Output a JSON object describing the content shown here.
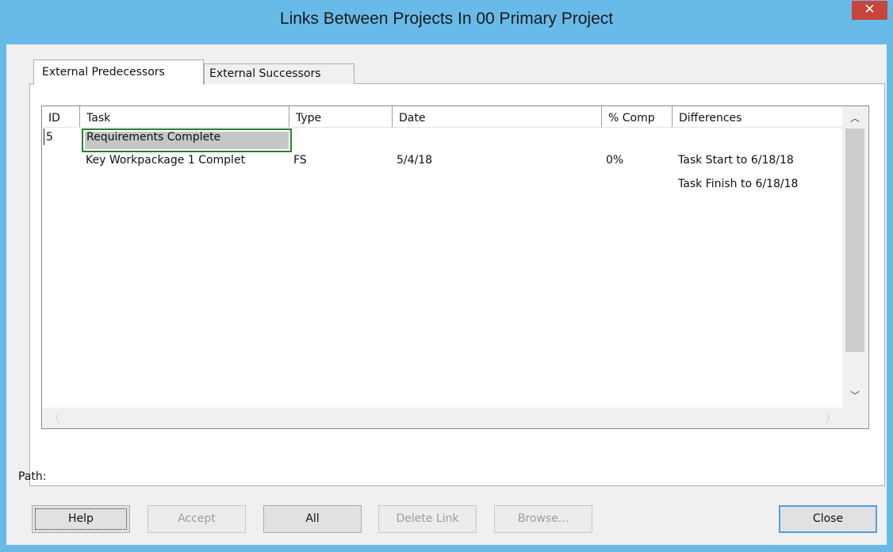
{
  "window": {
    "title": "Links Between Projects In 00 Primary Project",
    "close_glyph": "✕"
  },
  "tabs": [
    {
      "label": "External Predecessors",
      "active": true
    },
    {
      "label": "External Successors",
      "active": false
    }
  ],
  "grid": {
    "columns": [
      "ID",
      "Task",
      "Type",
      "Date",
      "% Comp",
      "Differences"
    ],
    "rows": [
      {
        "id": "5",
        "task": "Requirements Complete"
      },
      {
        "task": "Key Workpackage 1 Complet",
        "type": "FS",
        "date": "5/4/18",
        "pct": "0%",
        "differences": [
          "Task Start to 6/18/18",
          "Task Finish to 6/18/18"
        ]
      }
    ]
  },
  "path": {
    "label": "Path:"
  },
  "buttons": {
    "help": "Help",
    "accept": "Accept",
    "all": "All",
    "delete_link": "Delete Link",
    "browse": "Browse...",
    "close": "Close"
  },
  "colors": {
    "titlebar": "#68bbe9",
    "close_button": "#c7453b",
    "selection_border": "#2d7d32",
    "default_button_border": "#4ea1e4"
  }
}
